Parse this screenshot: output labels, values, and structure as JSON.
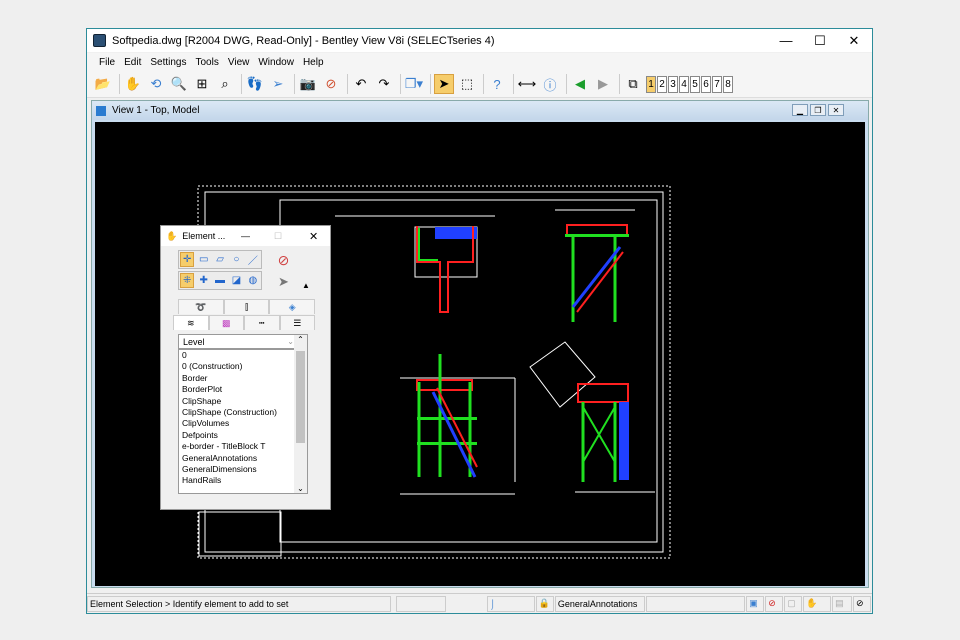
{
  "window": {
    "title": "Softpedia.dwg [R2004 DWG, Read-Only] - Bentley View V8i (SELECTseries 4)",
    "minimize": "—",
    "maximize": "☐",
    "close": "✕"
  },
  "menu": [
    "File",
    "Edit",
    "Settings",
    "Tools",
    "View",
    "Window",
    "Help"
  ],
  "toolbar": {
    "view_numbers": [
      "1",
      "2",
      "3",
      "4",
      "5",
      "6",
      "7",
      "8"
    ],
    "active_view": "1"
  },
  "view": {
    "title": "View 1 - Top, Model"
  },
  "panel": {
    "title": "Element ...",
    "list_header": "Level",
    "levels": [
      "0",
      "0 (Construction)",
      "Border",
      "BorderPlot",
      "ClipShape",
      "ClipShape (Construction)",
      "ClipVolumes",
      "Defpoints",
      "e-border - TitleBlock T",
      "GeneralAnnotations",
      "GeneralDimensions",
      "HandRails"
    ]
  },
  "status": {
    "prompt": "Element Selection > Identify element to add to set",
    "level": "GeneralAnnotations"
  },
  "colors": {
    "rail": "#ff2020",
    "structure": "#20e020",
    "stair": "#2040ff",
    "line": "#ffffff"
  }
}
